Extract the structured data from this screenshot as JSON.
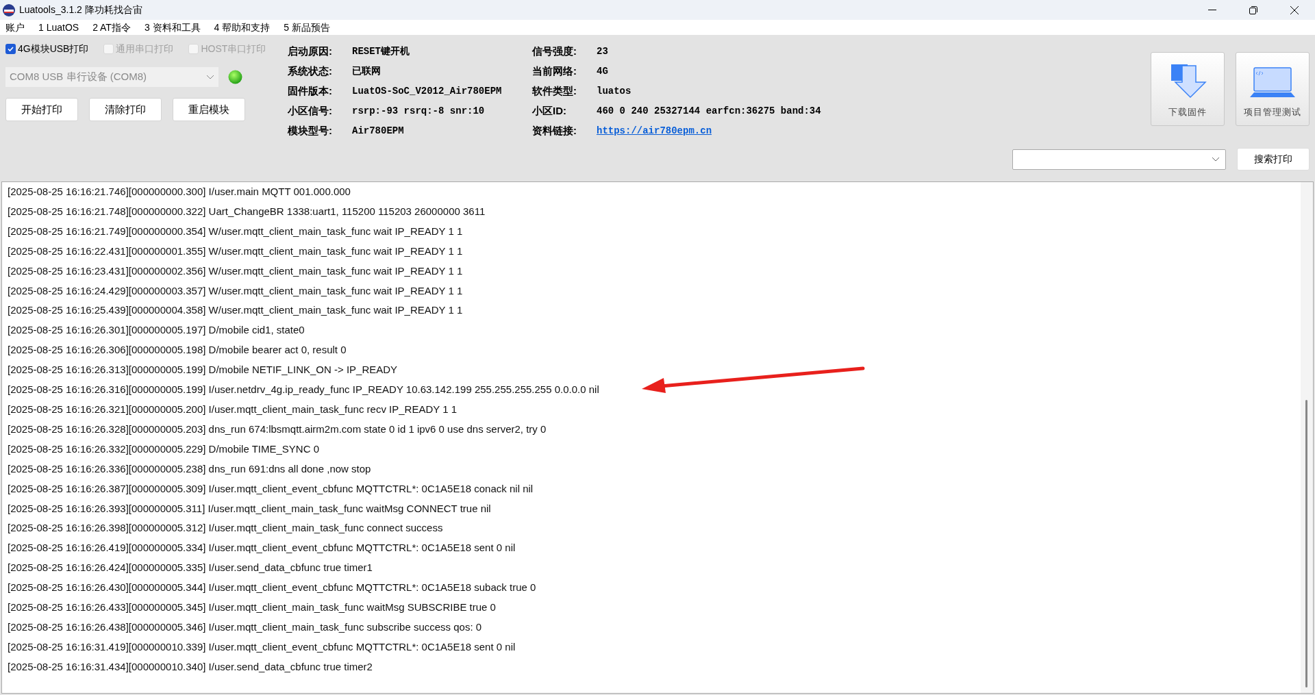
{
  "window": {
    "title": "Luatools_3.1.2 降功耗找合宙"
  },
  "menu": [
    "账户",
    "1 LuatOS",
    "2 AT指令",
    "3 资料和工具",
    "4 帮助和支持",
    "5 新品预告"
  ],
  "print_options": [
    {
      "label": "4G模块USB打印",
      "checked": true,
      "disabled": false
    },
    {
      "label": "通用串口打印",
      "checked": false,
      "disabled": true
    },
    {
      "label": "HOST串口打印",
      "checked": false,
      "disabled": true
    }
  ],
  "port_select": {
    "value": "COM8 USB 串行设备 (COM8)",
    "disabled": true
  },
  "actions": [
    "开始打印",
    "清除打印",
    "重启模块"
  ],
  "info": [
    [
      {
        "label": "启动原因:",
        "value": "RESET键开机",
        "kind": "text"
      },
      {
        "label": "系统状态:",
        "value": "已联网",
        "kind": "text"
      },
      {
        "label": "固件版本:",
        "value": "LuatOS-SoC_V2012_Air780EPM",
        "kind": "text"
      },
      {
        "label": "小区信号:",
        "value": "rsrp:-93 rsrq:-8 snr:10",
        "kind": "text"
      },
      {
        "label": "模块型号:",
        "value": "Air780EPM",
        "kind": "text"
      }
    ],
    [
      {
        "label": "信号强度:",
        "value": "23",
        "kind": "text"
      },
      {
        "label": "当前网络:",
        "value": "4G",
        "kind": "text"
      },
      {
        "label": "软件类型:",
        "value": "luatos",
        "kind": "text"
      },
      {
        "label": "小区ID:",
        "value": "460 0 240 25327144 earfcn:36275 band:34",
        "kind": "text"
      },
      {
        "label": "资料链接:",
        "value": "https://air780epm.cn",
        "kind": "link"
      }
    ]
  ],
  "tool_buttons": [
    {
      "label": "下载固件",
      "kind": "download"
    },
    {
      "label": "项目管理测试",
      "kind": "laptop"
    }
  ],
  "search_button": "搜索打印",
  "log": [
    "[2025-08-25 16:16:21.746][000000000.300] I/user.main MQTT 001.000.000",
    "[2025-08-25 16:16:21.748][000000000.322] Uart_ChangeBR 1338:uart1, 115200 115203 26000000 3611",
    "[2025-08-25 16:16:21.749][000000000.354] W/user.mqtt_client_main_task_func wait IP_READY 1 1",
    "[2025-08-25 16:16:22.431][000000001.355] W/user.mqtt_client_main_task_func wait IP_READY 1 1",
    "[2025-08-25 16:16:23.431][000000002.356] W/user.mqtt_client_main_task_func wait IP_READY 1 1",
    "[2025-08-25 16:16:24.429][000000003.357] W/user.mqtt_client_main_task_func wait IP_READY 1 1",
    "[2025-08-25 16:16:25.439][000000004.358] W/user.mqtt_client_main_task_func wait IP_READY 1 1",
    "[2025-08-25 16:16:26.301][000000005.197] D/mobile cid1, state0",
    "[2025-08-25 16:16:26.306][000000005.198] D/mobile bearer act 0, result 0",
    "[2025-08-25 16:16:26.313][000000005.199] D/mobile NETIF_LINK_ON -> IP_READY",
    "[2025-08-25 16:16:26.316][000000005.199] I/user.netdrv_4g.ip_ready_func IP_READY 10.63.142.199 255.255.255.255 0.0.0.0 nil",
    "[2025-08-25 16:16:26.321][000000005.200] I/user.mqtt_client_main_task_func recv IP_READY 1 1",
    "[2025-08-25 16:16:26.328][000000005.203] dns_run 674:lbsmqtt.airm2m.com state 0 id 1 ipv6 0 use dns server2, try 0",
    "[2025-08-25 16:16:26.332][000000005.229] D/mobile TIME_SYNC 0",
    "[2025-08-25 16:16:26.336][000000005.238] dns_run 691:dns all done ,now stop",
    "[2025-08-25 16:16:26.387][000000005.309] I/user.mqtt_client_event_cbfunc MQTTCTRL*: 0C1A5E18 conack nil nil",
    "[2025-08-25 16:16:26.393][000000005.311] I/user.mqtt_client_main_task_func waitMsg CONNECT true nil",
    "[2025-08-25 16:16:26.398][000000005.312] I/user.mqtt_client_main_task_func connect success",
    "[2025-08-25 16:16:26.419][000000005.334] I/user.mqtt_client_event_cbfunc MQTTCTRL*: 0C1A5E18 sent 0 nil",
    "[2025-08-25 16:16:26.424][000000005.335] I/user.send_data_cbfunc true timer1",
    "[2025-08-25 16:16:26.430][000000005.344] I/user.mqtt_client_event_cbfunc MQTTCTRL*: 0C1A5E18 suback true 0",
    "[2025-08-25 16:16:26.433][000000005.345] I/user.mqtt_client_main_task_func waitMsg SUBSCRIBE true 0",
    "[2025-08-25 16:16:26.438][000000005.346] I/user.mqtt_client_main_task_func subscribe success qos: 0",
    "[2025-08-25 16:16:31.419][000000010.339] I/user.mqtt_client_event_cbfunc MQTTCTRL*: 0C1A5E18 sent 0 nil",
    "[2025-08-25 16:16:31.434][000000010.340] I/user.send_data_cbfunc true timer2"
  ]
}
